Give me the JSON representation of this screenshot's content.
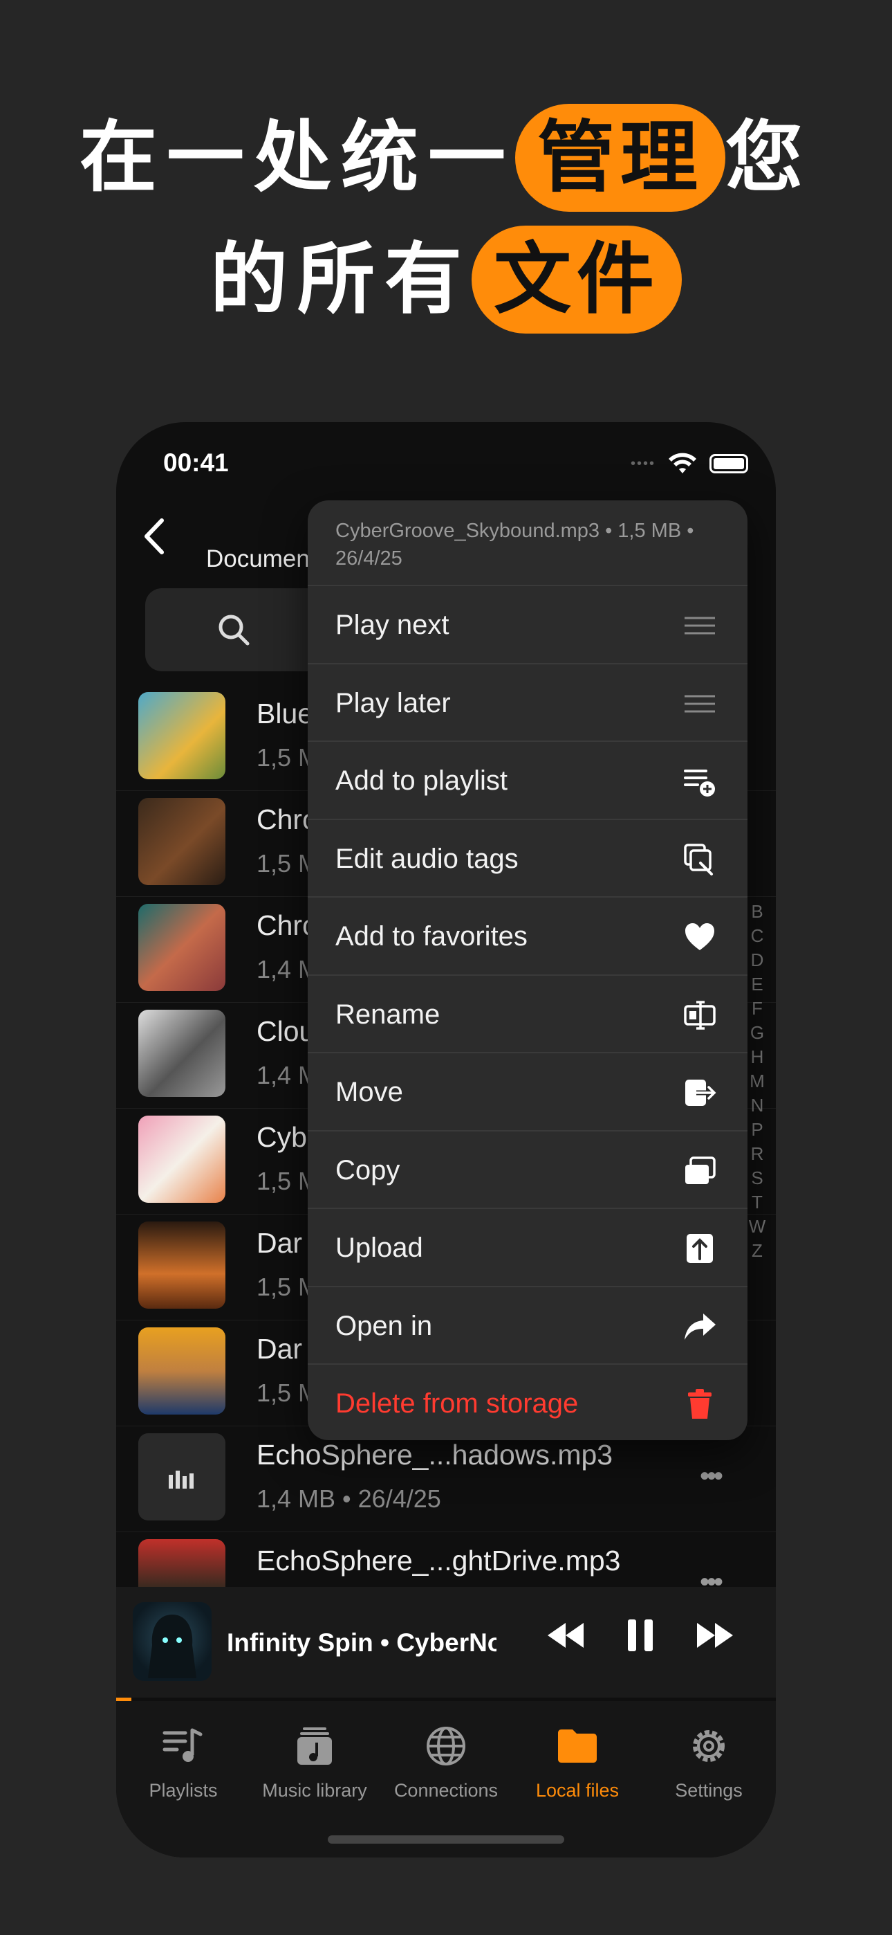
{
  "headline": {
    "line1_pre": "在一处统一",
    "line1_pill": "管理",
    "line1_post": "您",
    "line2_pre": "的所有",
    "line2_pill": "文件"
  },
  "status": {
    "time": "00:41"
  },
  "nav": {
    "title": "Documen"
  },
  "list": [
    {
      "title": "Blue",
      "sub": "1,5 M"
    },
    {
      "title": "Chro",
      "sub": "1,5 M"
    },
    {
      "title": "Chro",
      "sub": "1,4 M"
    },
    {
      "title": "Clou",
      "sub": "1,4 M"
    },
    {
      "title": "Cyb",
      "sub": "1,5 M"
    },
    {
      "title": "Dar",
      "sub": "1,5 M"
    },
    {
      "title": "Dar",
      "sub": "1,5 M"
    },
    {
      "title": "EchoSphere_...hadows.mp3",
      "sub": "1,4 MB • 26/4/25"
    },
    {
      "title": "EchoSphere_...ghtDrive.mp3",
      "sub": ""
    }
  ],
  "index_letters": "B C D E F G H M N P R S T W Z",
  "menu": {
    "header": "CyberGroove_Skybound.mp3 • 1,5 MB • 26/4/25",
    "items": [
      {
        "label": "Play next",
        "icon": "lines-icon"
      },
      {
        "label": "Play later",
        "icon": "lines-icon"
      },
      {
        "label": "Add to playlist",
        "icon": "playlist-add-icon"
      },
      {
        "label": "Edit audio tags",
        "icon": "edit-tags-icon"
      },
      {
        "label": "Add to favorites",
        "icon": "heart-icon"
      },
      {
        "label": "Rename",
        "icon": "rename-icon"
      },
      {
        "label": "Move",
        "icon": "move-icon"
      },
      {
        "label": "Copy",
        "icon": "copy-icon"
      },
      {
        "label": "Upload",
        "icon": "upload-icon"
      },
      {
        "label": "Open in",
        "icon": "share-icon"
      },
      {
        "label": "Delete from storage",
        "icon": "trash-icon"
      }
    ]
  },
  "player": {
    "now_playing": "Infinity Spin • CyberNo"
  },
  "tabs": [
    {
      "label": "Playlists"
    },
    {
      "label": "Music library"
    },
    {
      "label": "Connections"
    },
    {
      "label": "Local files"
    },
    {
      "label": "Settings"
    }
  ],
  "colors": {
    "accent": "#ff8c0a",
    "danger": "#ff3b30",
    "background": "#262626"
  }
}
